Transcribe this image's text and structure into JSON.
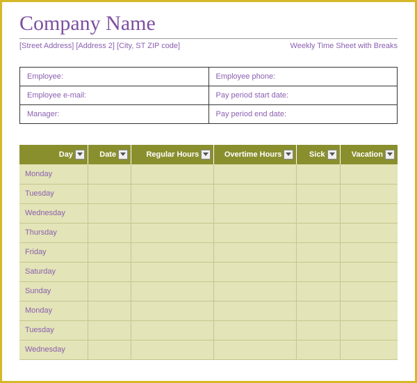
{
  "header": {
    "company": "Company Name",
    "address": "[Street Address] [Address 2] [City, ST ZIP code]",
    "doc_title": "Weekly Time Sheet with Breaks"
  },
  "info": {
    "employee_label": "Employee:",
    "employee_phone_label": "Employee phone:",
    "employee_email_label": "Employee e-mail:",
    "pay_start_label": "Pay period start date:",
    "manager_label": "Manager:",
    "pay_end_label": "Pay period end date:"
  },
  "columns": {
    "day": "Day",
    "date": "Date",
    "regular": "Regular Hours",
    "overtime": "Overtime Hours",
    "sick": "Sick",
    "vacation": "Vacation"
  },
  "rows": [
    {
      "day": "Monday"
    },
    {
      "day": "Tuesday"
    },
    {
      "day": "Wednesday"
    },
    {
      "day": "Thursday"
    },
    {
      "day": "Friday"
    },
    {
      "day": "Saturday"
    },
    {
      "day": "Sunday"
    },
    {
      "day": "Monday"
    },
    {
      "day": "Tuesday"
    },
    {
      "day": "Wednesday"
    }
  ],
  "chart_data": {
    "type": "table",
    "title": "Weekly Time Sheet with Breaks",
    "columns": [
      "Day",
      "Date",
      "Regular Hours",
      "Overtime Hours",
      "Sick",
      "Vacation"
    ],
    "rows": [
      [
        "Monday",
        "",
        "",
        "",
        "",
        ""
      ],
      [
        "Tuesday",
        "",
        "",
        "",
        "",
        ""
      ],
      [
        "Wednesday",
        "",
        "",
        "",
        "",
        ""
      ],
      [
        "Thursday",
        "",
        "",
        "",
        "",
        ""
      ],
      [
        "Friday",
        "",
        "",
        "",
        "",
        ""
      ],
      [
        "Saturday",
        "",
        "",
        "",
        "",
        ""
      ],
      [
        "Sunday",
        "",
        "",
        "",
        "",
        ""
      ],
      [
        "Monday",
        "",
        "",
        "",
        "",
        ""
      ],
      [
        "Tuesday",
        "",
        "",
        "",
        "",
        ""
      ],
      [
        "Wednesday",
        "",
        "",
        "",
        "",
        ""
      ]
    ]
  }
}
